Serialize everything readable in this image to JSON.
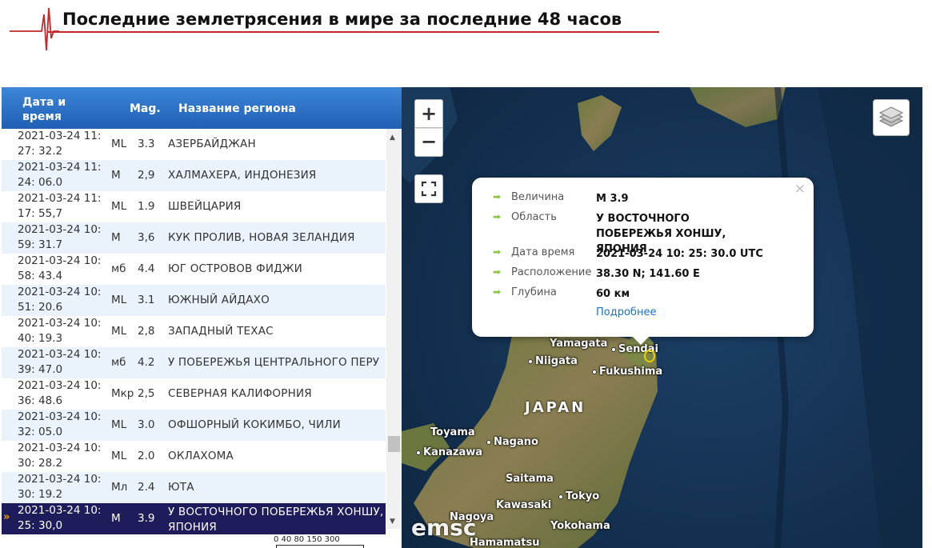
{
  "header": {
    "title": "Последние землетрясения в мире за последние 48 часов",
    "accent_color": "#c62828"
  },
  "table": {
    "columns": {
      "datetime": "Дата и время",
      "mag": "Mag.",
      "region": "Название региона"
    },
    "header_color": "#2a6ec6",
    "rows": [
      {
        "datetime": "2021-03-24 11: 27: 32.2",
        "type": "ML",
        "mag": "3.3",
        "region": "АЗЕРБАЙДЖАН"
      },
      {
        "datetime": "2021-03-24 11: 24: 06.0",
        "type": "M",
        "mag": "2,9",
        "region": "ХАЛМАХЕРА, ИНДОНЕЗИЯ"
      },
      {
        "datetime": "2021-03-24 11: 17: 55,7",
        "type": "ML",
        "mag": "1.9",
        "region": "ШВЕЙЦАРИЯ"
      },
      {
        "datetime": "2021-03-24 10: 59: 31.7",
        "type": "M",
        "mag": "3,6",
        "region": "КУК ПРОЛИВ, НОВАЯ ЗЕЛАНДИЯ"
      },
      {
        "datetime": "2021-03-24 10: 58: 43.4",
        "type": "мб",
        "mag": "4.4",
        "region": "ЮГ ОСТРОВОВ ФИДЖИ"
      },
      {
        "datetime": "2021-03-24 10: 51: 20.6",
        "type": "ML",
        "mag": "3.1",
        "region": "ЮЖНЫЙ АЙДАХО"
      },
      {
        "datetime": "2021-03-24 10: 40: 19.3",
        "type": "ML",
        "mag": "2,8",
        "region": "ЗАПАДНЫЙ ТЕХАС"
      },
      {
        "datetime": "2021-03-24 10: 39: 47.0",
        "type": "мб",
        "mag": "4.2",
        "region": "У ПОБЕРЕЖЬЯ ЦЕНТРАЛЬНОГО ПЕРУ"
      },
      {
        "datetime": "2021-03-24 10: 36: 48.6",
        "type": "Мкр",
        "mag": "2,5",
        "region": "СЕВЕРНАЯ КАЛИФОРНИЯ"
      },
      {
        "datetime": "2021-03-24 10: 32: 05.0",
        "type": "ML",
        "mag": "3.0",
        "region": "ОФШОРНЫЙ КОКИМБО, ЧИЛИ"
      },
      {
        "datetime": "2021-03-24 10: 30: 28.2",
        "type": "ML",
        "mag": "2.0",
        "region": "ОКЛАХОМА"
      },
      {
        "datetime": "2021-03-24 10: 30: 19.2",
        "type": "Мл",
        "mag": "2.4",
        "region": "ЮТА"
      },
      {
        "datetime": "2021-03-24 10: 25: 30,0",
        "type": "M",
        "mag": "3.9",
        "region": "У ВОСТОЧНОГО ПОБЕРЕЖЬЯ ХОНШУ, ЯПОНИЯ",
        "selected": true
      }
    ],
    "selected_marker": "»",
    "selected_color": "#1f1c5c"
  },
  "scale": {
    "ticks": "0 40 80 150 300"
  },
  "map": {
    "controls": {
      "zoom_in": "+",
      "zoom_out": "−"
    },
    "country": "JAPAN",
    "watermark": "emsc",
    "places": [
      {
        "name": "Yamagata"
      },
      {
        "name": "Sendai"
      },
      {
        "name": "Niigata"
      },
      {
        "name": "Fukushima"
      },
      {
        "name": "Toyama"
      },
      {
        "name": "Nagano"
      },
      {
        "name": "Kanazawa"
      },
      {
        "name": "Saitama"
      },
      {
        "name": "Tokyo"
      },
      {
        "name": "Kawasaki"
      },
      {
        "name": "Yokohama"
      },
      {
        "name": "Nagoya"
      },
      {
        "name": "Hamamatsu"
      }
    ],
    "popup": {
      "close": "×",
      "fields": [
        {
          "label": "Величина",
          "value": "M 3.9"
        },
        {
          "label": "Область",
          "value": "У ВОСТОЧНОГО ПОБЕРЕЖЬЯ ХОНШУ, ЯПОНИЯ"
        },
        {
          "label": "Дата время",
          "value": "2021-03-24 10: 25: 30.0 UTC"
        },
        {
          "label": "Расположение",
          "value": "38.30 N; 141.60 E"
        },
        {
          "label": "Глубина",
          "value": "60 км"
        }
      ],
      "more_link": "Подробнее"
    }
  }
}
